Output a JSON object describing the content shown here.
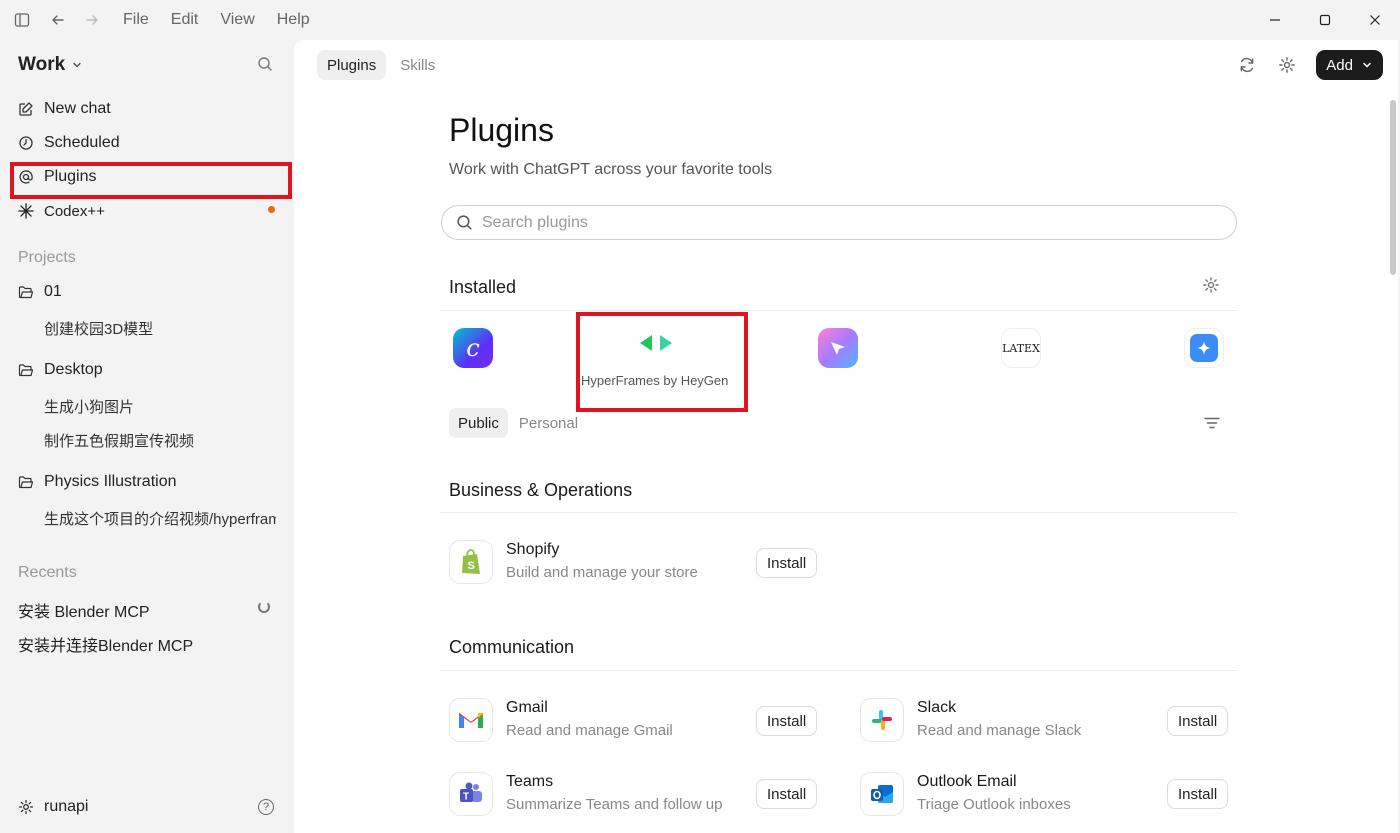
{
  "menu": {
    "items": [
      "File",
      "Edit",
      "View",
      "Help"
    ]
  },
  "sidebar": {
    "workspace": "Work",
    "nav": [
      {
        "label": "New chat",
        "icon": "edit-icon"
      },
      {
        "label": "Scheduled",
        "icon": "clock-icon"
      },
      {
        "label": "Plugins",
        "icon": "at-icon"
      },
      {
        "label": "Codex++",
        "icon": "asterisk-icon"
      }
    ],
    "projects_label": "Projects",
    "projects": [
      {
        "name": "01",
        "chats": [
          "创建校园3D模型"
        ]
      },
      {
        "name": "Desktop",
        "chats": [
          "生成小狗图片",
          "制作五色假期宣传视频"
        ]
      },
      {
        "name": "Physics Illustration",
        "chats": [
          "生成这个项目的介绍视频/hyperframes"
        ]
      }
    ],
    "recents_label": "Recents",
    "recents": [
      "安装 Blender MCP",
      "安装并连接Blender MCP"
    ],
    "user": "runapi",
    "help": "?"
  },
  "main": {
    "tabs": [
      "Plugins",
      "Skills"
    ],
    "add_label": "Add",
    "title": "Plugins",
    "subtitle": "Work with ChatGPT across your favorite tools",
    "search_placeholder": "Search plugins",
    "installed_label": "Installed",
    "installed": [
      {
        "name": "Canva",
        "icon": "canva-icon"
      },
      {
        "name": "HyperFrames by HeyGen",
        "icon": "hyperframes-icon",
        "label_shown": "HyperFrames by HeyGen"
      },
      {
        "name": "Send",
        "icon": "send-icon"
      },
      {
        "name": "LaTeX",
        "icon": "latex-icon",
        "text": "LATEX"
      },
      {
        "name": "Sparkle",
        "icon": "sparkle-icon"
      }
    ],
    "subtabs": [
      "Public",
      "Personal"
    ],
    "categories": [
      {
        "name": "Business & Operations",
        "plugins": [
          {
            "name": "Shopify",
            "desc": "Build and manage your store",
            "action": "Install"
          }
        ]
      },
      {
        "name": "Communication",
        "plugins": [
          {
            "name": "Gmail",
            "desc": "Read and manage Gmail",
            "action": "Install"
          },
          {
            "name": "Slack",
            "desc": "Read and manage Slack",
            "action": "Install"
          },
          {
            "name": "Teams",
            "desc": "Summarize Teams and follow up",
            "action": "Install"
          },
          {
            "name": "Outlook Email",
            "desc": "Triage Outlook inboxes",
            "action": "Install"
          }
        ]
      }
    ]
  },
  "colors": {
    "highlight": "#e0141e",
    "accent_dot": "#e8691b",
    "add_button": "#1c1c1c"
  }
}
